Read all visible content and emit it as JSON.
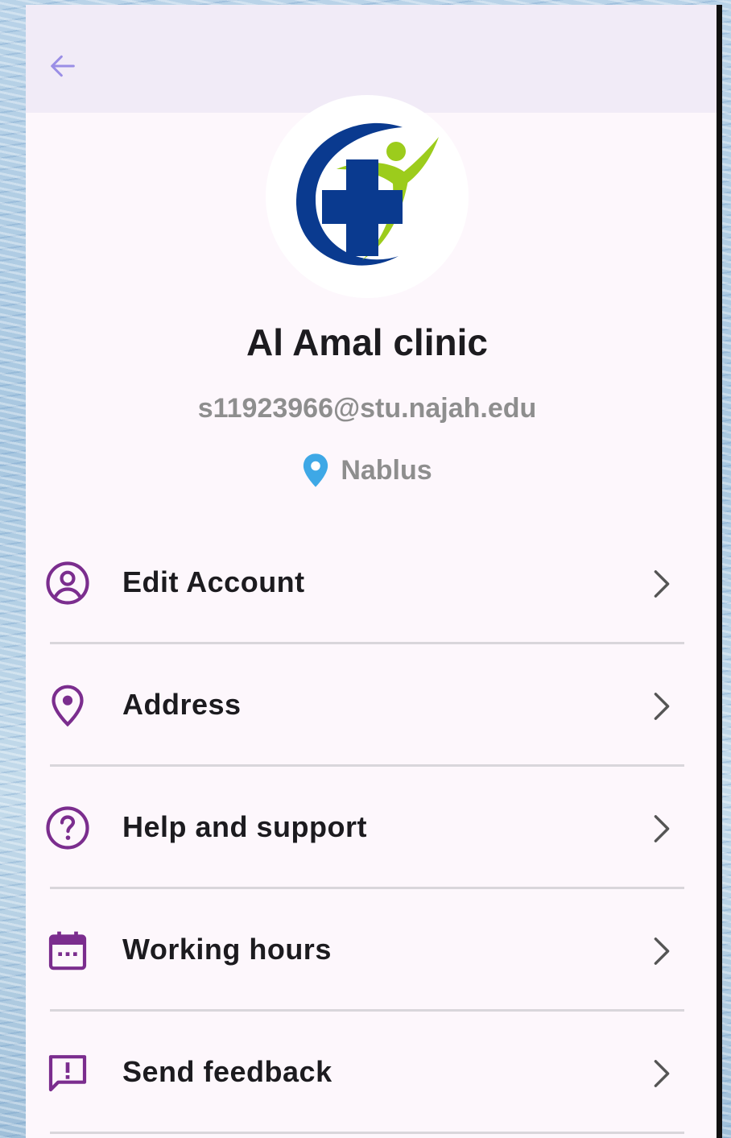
{
  "colors": {
    "accent_purple": "#7b2d8e",
    "back_arrow": "#9a8ee6",
    "pin_blue": "#3ea8e6",
    "logo_blue": "#0a3a8f",
    "logo_green": "#9ccc1c",
    "appbar_bg": "#f1ebf7",
    "page_bg": "#fdf7fc"
  },
  "appbar": {
    "back_icon": "arrow-left-icon"
  },
  "profile": {
    "name": "Al Amal clinic",
    "email": "s11923966@stu.najah.edu",
    "location": "Nablus",
    "location_icon": "map-pin-icon"
  },
  "menu": {
    "items": [
      {
        "label": "Edit Account",
        "icon": "user-circle-icon"
      },
      {
        "label": "Address",
        "icon": "location-pin-icon"
      },
      {
        "label": "Help and support",
        "icon": "help-circle-icon"
      },
      {
        "label": "Working hours",
        "icon": "calendar-icon"
      },
      {
        "label": "Send feedback",
        "icon": "feedback-icon"
      }
    ],
    "chevron_icon": "chevron-right-icon"
  }
}
